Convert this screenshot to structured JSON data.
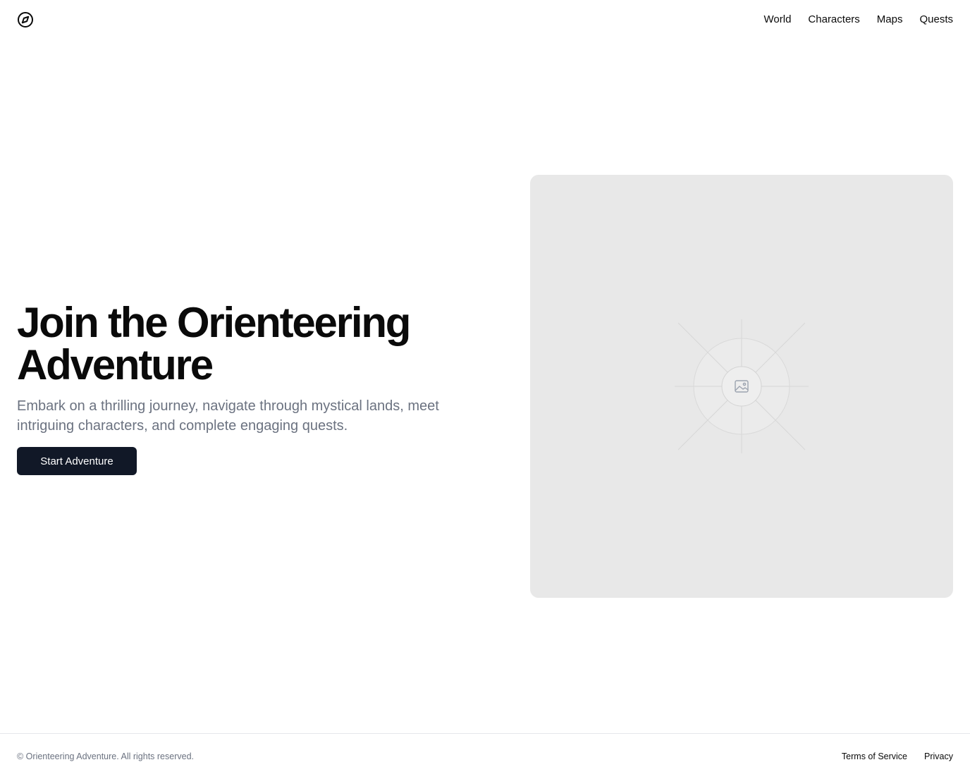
{
  "header": {
    "logo_icon": "compass-icon",
    "nav": [
      {
        "label": "World"
      },
      {
        "label": "Characters"
      },
      {
        "label": "Maps"
      },
      {
        "label": "Quests"
      }
    ]
  },
  "hero": {
    "title_line1": "Join the Orienteering",
    "title_line2": "Adventure",
    "subtitle": "Embark on a thrilling journey, navigate through mystical lands, meet intriguing characters, and complete engaging quests.",
    "cta_label": "Start Adventure",
    "image_icon": "image-placeholder-icon"
  },
  "footer": {
    "copyright": "© Orienteering Adventure. All rights reserved.",
    "links": [
      {
        "label": "Terms of Service"
      },
      {
        "label": "Privacy"
      }
    ]
  },
  "colors": {
    "primary_button": "#111827",
    "muted_text": "#6b7280",
    "placeholder_bg": "#e8e8e8"
  }
}
